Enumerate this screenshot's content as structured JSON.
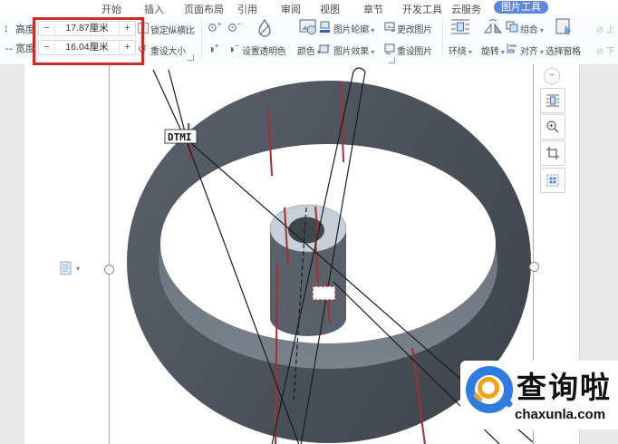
{
  "tab_bar": {
    "tabs": [
      {
        "label": "开始"
      },
      {
        "label": "插入"
      },
      {
        "label": "页面布局"
      },
      {
        "label": "引用"
      },
      {
        "label": "审阅"
      },
      {
        "label": "视图"
      },
      {
        "label": "章节"
      },
      {
        "label": "开发工具"
      },
      {
        "label": "云服务"
      },
      {
        "label": "图片工具",
        "active": true
      }
    ]
  },
  "ribbon": {
    "height_label": "高度",
    "width_label": "宽度",
    "height_value": "17.87厘米",
    "width_value": "16.04厘米",
    "lock_aspect_label": "锁定纵横比",
    "reset_size_label": "重设大小",
    "set_transparent_label": "设置透明色",
    "color_label": "颜色",
    "picture_outline_label": "图片轮廓",
    "picture_effects_label": "图片效果",
    "change_picture_label": "更改图片",
    "reset_picture_label": "重设图片",
    "wrap_label": "环绕",
    "rotate_label": "旋转",
    "group_label": "组合",
    "align_label": "对齐",
    "selection_pane_label": "选择窗格",
    "bring_forward_label": "上",
    "send_backward_label": "下"
  },
  "icons": {
    "minus": "−",
    "plus": "+",
    "caret_down": "▾",
    "check": "✓",
    "height_glyph": "↕",
    "width_glyph": "↔",
    "reset_size_glyph": "↺",
    "brightness_glyph": "⊙",
    "contrast_glyph": "◑",
    "plus_sign": "+",
    "minus_sign": "−",
    "layer_glyph": "⊘",
    "collapse_glyph": "−"
  },
  "document": {
    "image_label": "DTMI"
  },
  "watermark": {
    "name": "查询啦",
    "domain": "chaxunla.com"
  },
  "colors": {
    "active_tab_bg": "#5b87de",
    "highlight_box": "#cf2a23",
    "ring_grey": "#4a515a",
    "red_line": "#a33030",
    "logo_blue": "#2e7ce2",
    "logo_orange": "#f6a013"
  }
}
